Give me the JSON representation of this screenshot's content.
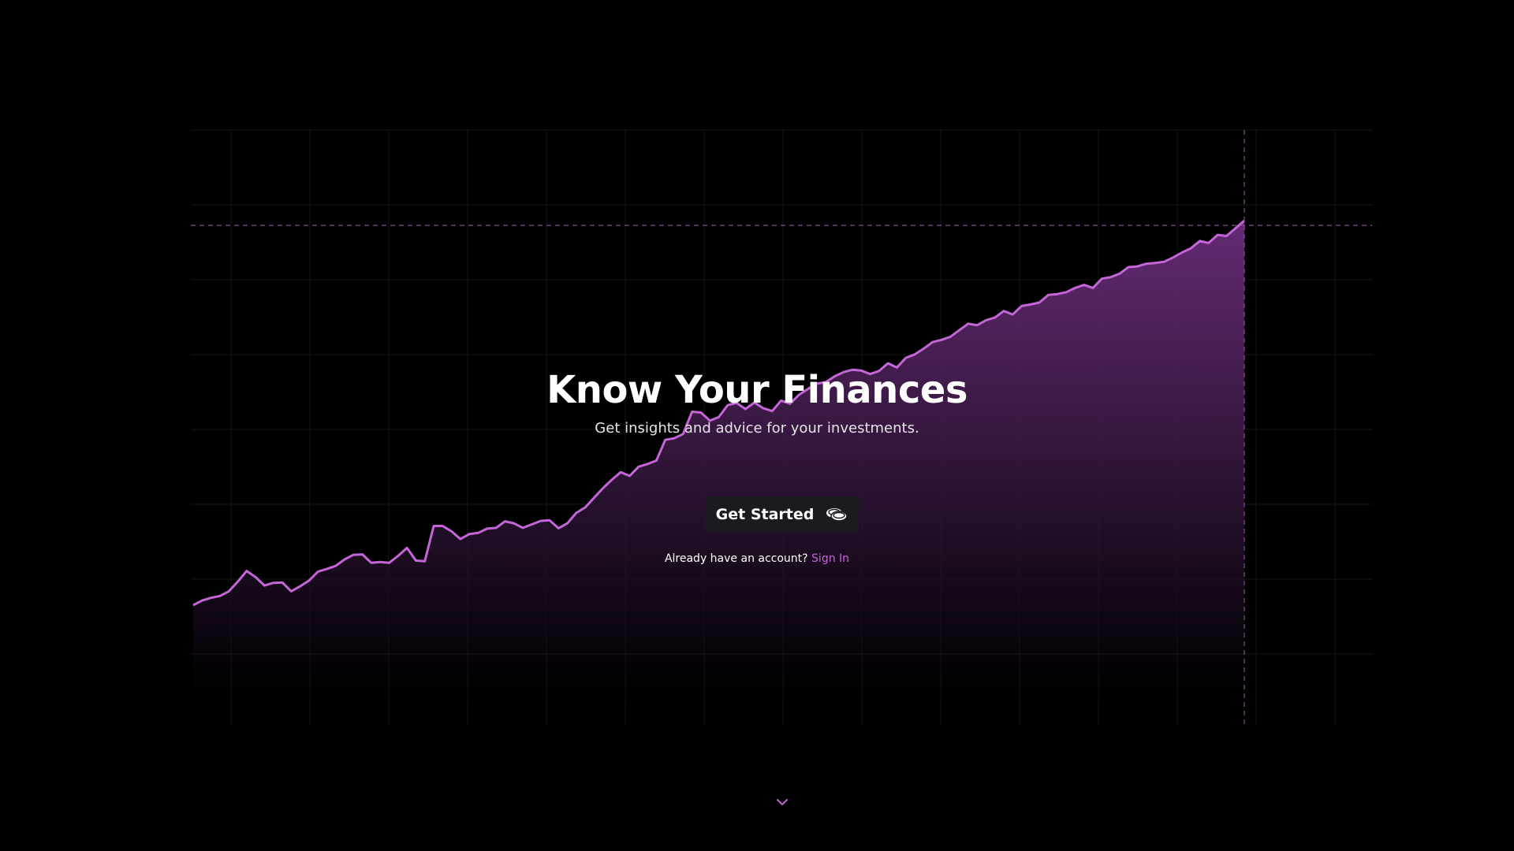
{
  "hero": {
    "title": "Know Your Finances",
    "subtitle": "Get insights and advice for your investments.",
    "cta_label": "Get Started",
    "cta_icon": "coins-icon",
    "signin_prompt": "Already have an account?",
    "signin_link": "Sign In",
    "scroll_icon": "chevron-down-icon"
  },
  "colors": {
    "background": "#000000",
    "accent": "#c466d8",
    "line": "#c466d8",
    "grid": "#161616",
    "button_bg": "#1c1a20"
  },
  "chart_data": {
    "type": "area",
    "grid": true,
    "series": [
      {
        "values": [
          0.0,
          1.2,
          1.9,
          2.4,
          3.6,
          6.1,
          8.9,
          7.3,
          5.1,
          5.8,
          5.9,
          3.6,
          4.9,
          6.4,
          8.7,
          9.4,
          10.2,
          11.9,
          13.1,
          13.2,
          11.0,
          11.2,
          11.0,
          12.8,
          14.9,
          11.6,
          11.4,
          20.6,
          20.6,
          19.2,
          17.2,
          18.5,
          18.8,
          19.9,
          20.1,
          21.8,
          21.3,
          20.1,
          21.0,
          21.9,
          22.1,
          20.0,
          21.3,
          24.0,
          25.4,
          27.9,
          30.4,
          32.6,
          34.6,
          33.6,
          36.0,
          36.7,
          37.6,
          43.0,
          43.4,
          44.5,
          50.3,
          50.1,
          48.0,
          48.9,
          52.0,
          52.6,
          51.0,
          52.7,
          51.2,
          50.5,
          53.2,
          52.4,
          54.7,
          56.2,
          57.6,
          58.0,
          59.5,
          60.6,
          61.2,
          61.0,
          60.1,
          60.9,
          62.9,
          61.8,
          64.3,
          65.2,
          66.7,
          68.4,
          69.0,
          69.8,
          71.5,
          73.2,
          72.8,
          74.1,
          74.8,
          76.5,
          75.6,
          77.8,
          78.2,
          78.7,
          80.7,
          80.9,
          81.4,
          82.5,
          83.3,
          82.5,
          84.9,
          85.3,
          86.2,
          87.9,
          88.1,
          88.8,
          89.0,
          89.3,
          90.4,
          91.7,
          92.8,
          94.7,
          94.2,
          96.3,
          96.0,
          98.0,
          100.0
        ]
      }
    ]
  }
}
